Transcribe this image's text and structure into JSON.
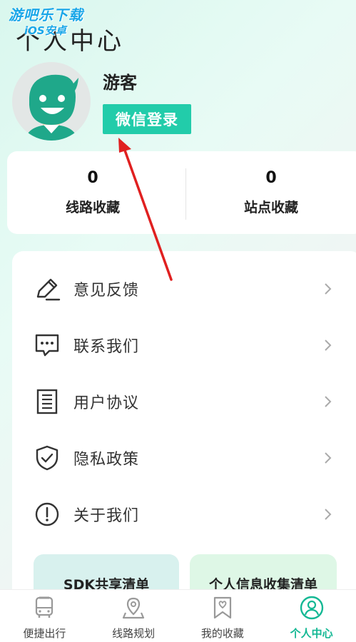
{
  "watermark": {
    "line1": "游吧乐下载",
    "line2": "iOS安卓"
  },
  "header": {
    "title": "个人中心"
  },
  "profile": {
    "username": "游客",
    "login_button": "微信登录"
  },
  "stats": [
    {
      "value": "0",
      "label": "线路收藏"
    },
    {
      "value": "0",
      "label": "站点收藏"
    }
  ],
  "menu": [
    {
      "label": "意见反馈",
      "icon": "edit-pen-icon"
    },
    {
      "label": "联系我们",
      "icon": "chat-bubble-icon"
    },
    {
      "label": "用户协议",
      "icon": "document-icon"
    },
    {
      "label": "隐私政策",
      "icon": "shield-check-icon"
    },
    {
      "label": "关于我们",
      "icon": "info-circle-icon"
    }
  ],
  "documents": {
    "sdk": "SDK共享清单",
    "info": "个人信息收集清单"
  },
  "tabbar": [
    {
      "label": "便捷出行",
      "icon": "bus-icon",
      "active": false
    },
    {
      "label": "线路规划",
      "icon": "location-pin-icon",
      "active": false
    },
    {
      "label": "我的收藏",
      "icon": "favorite-bookmark-icon",
      "active": false
    },
    {
      "label": "个人中心",
      "icon": "user-profile-icon",
      "active": true
    }
  ],
  "colors": {
    "accent": "#22ccaa",
    "active_tab": "#14b894",
    "annotation_arrow": "#e02020"
  }
}
